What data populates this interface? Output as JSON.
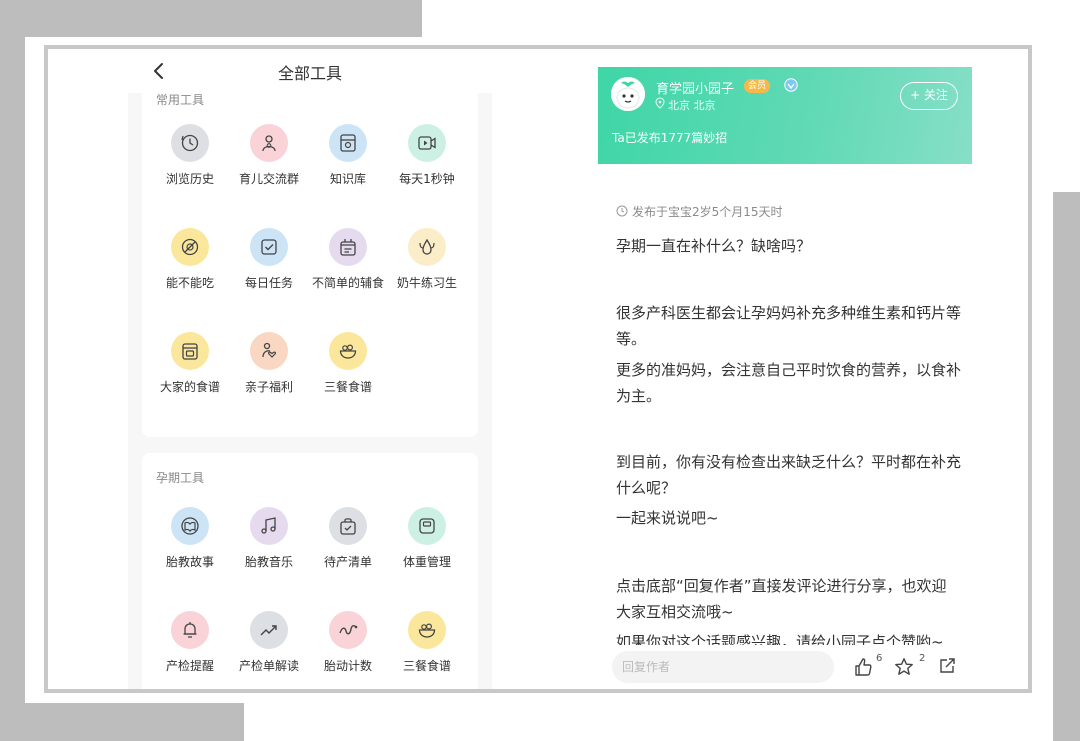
{
  "left": {
    "header": {
      "title": "全部工具"
    },
    "common": {
      "title": "常用工具",
      "items": [
        {
          "label": "浏览历史",
          "icon": "history-icon",
          "color": "#dcdfe3"
        },
        {
          "label": "育儿交流群",
          "icon": "parenting-group-icon",
          "color": "#f9d3d8"
        },
        {
          "label": "知识库",
          "icon": "knowledge-base-icon",
          "color": "#cde4f6"
        },
        {
          "label": "每天1秒钟",
          "icon": "video-icon",
          "color": "#cdf0e4"
        },
        {
          "label": "能不能吃",
          "icon": "food-check-icon",
          "color": "#fbe79b"
        },
        {
          "label": "每日任务",
          "icon": "task-check-icon",
          "color": "#cde4f6"
        },
        {
          "label": "不简单的辅食",
          "icon": "baby-food-icon",
          "color": "#e6daef"
        },
        {
          "label": "奶牛练习生",
          "icon": "milk-drop-icon",
          "color": "#fcedc9"
        },
        {
          "label": "大家的食谱",
          "icon": "recipe-icon",
          "color": "#fbe79b"
        },
        {
          "label": "亲子福利",
          "icon": "gift-icon",
          "color": "#f9d7c2"
        },
        {
          "label": "三餐食谱",
          "icon": "meal-bowl-icon",
          "color": "#fbe79b"
        }
      ]
    },
    "pregnancy": {
      "title": "孕期工具",
      "items": [
        {
          "label": "胎教故事",
          "icon": "story-book-icon",
          "color": "#cde4f6"
        },
        {
          "label": "胎教音乐",
          "icon": "music-note-icon",
          "color": "#e6daef"
        },
        {
          "label": "待产清单",
          "icon": "bag-checklist-icon",
          "color": "#dcdfe3"
        },
        {
          "label": "体重管理",
          "icon": "scale-icon",
          "color": "#cdf0e4"
        },
        {
          "label": "产检提醒",
          "icon": "bell-icon",
          "color": "#f9d3d8"
        },
        {
          "label": "产检单解读",
          "icon": "trend-chart-icon",
          "color": "#dcdfe3"
        },
        {
          "label": "胎动计数",
          "icon": "wave-icon",
          "color": "#f9d3d8"
        },
        {
          "label": "三餐食谱",
          "icon": "meal-bowl-icon",
          "color": "#fbe79b"
        }
      ]
    }
  },
  "right": {
    "author": {
      "name": "育学园小园子",
      "badge": "会员",
      "location": "北京 北京",
      "follow_label": "+ 关注",
      "posts_text": "Ta已发布1777篇妙招"
    },
    "post": {
      "meta": "发布于宝宝2岁5个月15天时",
      "paragraphs": [
        "孕期一直在补什么？缺啥吗？",
        "很多产科医生都会让孕妈妈补充多种维生素和钙片等等。",
        "更多的准妈妈，会注意自己平时饮食的营养，以食补为主。",
        "到目前，你有没有检查出来缺乏什么？平时都在补充什么呢？",
        "一起来说说吧~",
        "点击底部“回复作者”直接发评论进行分享，也欢迎大家互相交流哦~",
        "如果你对这个话题感兴趣，请给小园子点个赞哟~"
      ]
    },
    "bottom": {
      "reply_placeholder": "回复作者",
      "like_count": "6",
      "star_count": "2"
    }
  },
  "colors": {
    "accent": "#3fd6a6",
    "text": "#333333",
    "muted": "#888888"
  }
}
